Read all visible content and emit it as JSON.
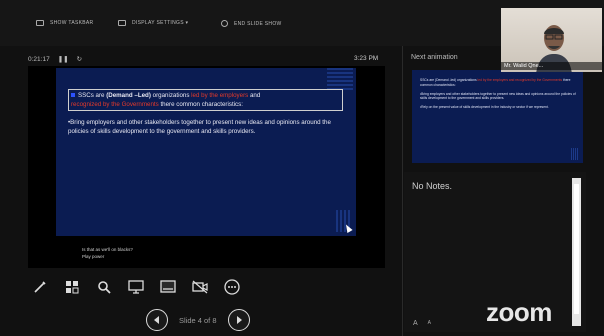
{
  "toolbar": {
    "show_taskbar": "SHOW TASKBAR",
    "display_settings": "DISPLAY SETTINGS ▾",
    "end_slide_show": "END SLIDE SHOW"
  },
  "presenter": {
    "elapsed": "0:21:17",
    "clock": "3:23 PM"
  },
  "slide": {
    "line1_a": "SSCs are ",
    "line1_b": "(Demand –Led)",
    "line1_c": " organizations ",
    "line1_d": "led by the employers",
    "line1_e": " and ",
    "line2_a": "recognized by the Governments",
    "line2_b": " there common characteristics:",
    "bullet": "•Bring employers and other stakeholders together to present new ideas and opinions around the policies of skills development to the government and skills providers.",
    "caption1": "Is that as we'll on blacks?",
    "caption2": "Play power"
  },
  "next": {
    "label": "Next animation",
    "p1_a": "SSCs are (Demand -led) organizations ",
    "p1_b": "led by the employers and recognized by the Governments",
    "p1_c": " there common characteristics:",
    "p2": "•Bring employers and other stakeholders together to present new ideas and opinions around the policies of skills development to the government and skills providers.",
    "p3": "•Rely on the present value of skills development in the industry or sector if we represent."
  },
  "notes": {
    "text": "No Notes.",
    "font_up": "A",
    "font_down": "A"
  },
  "navigation": {
    "slide_indicator": "Slide 4 of 8"
  },
  "video": {
    "participant": "Mr. Walid Qne..."
  },
  "brand": {
    "zoom": "zoom"
  },
  "colors": {
    "slide_bg": "#0b1c52",
    "highlight_red": "#e43a2a",
    "bullet_blue": "#2c52ff"
  },
  "icons": [
    "display-icon",
    "taskbar-icon",
    "end-show-icon",
    "pen-icon",
    "see-all-slides-icon",
    "zoom-in-icon",
    "screen-icon",
    "subtitles-icon",
    "camera-off-icon",
    "more-icon",
    "previous-icon",
    "next-icon",
    "pause-icon",
    "reset-icon"
  ]
}
